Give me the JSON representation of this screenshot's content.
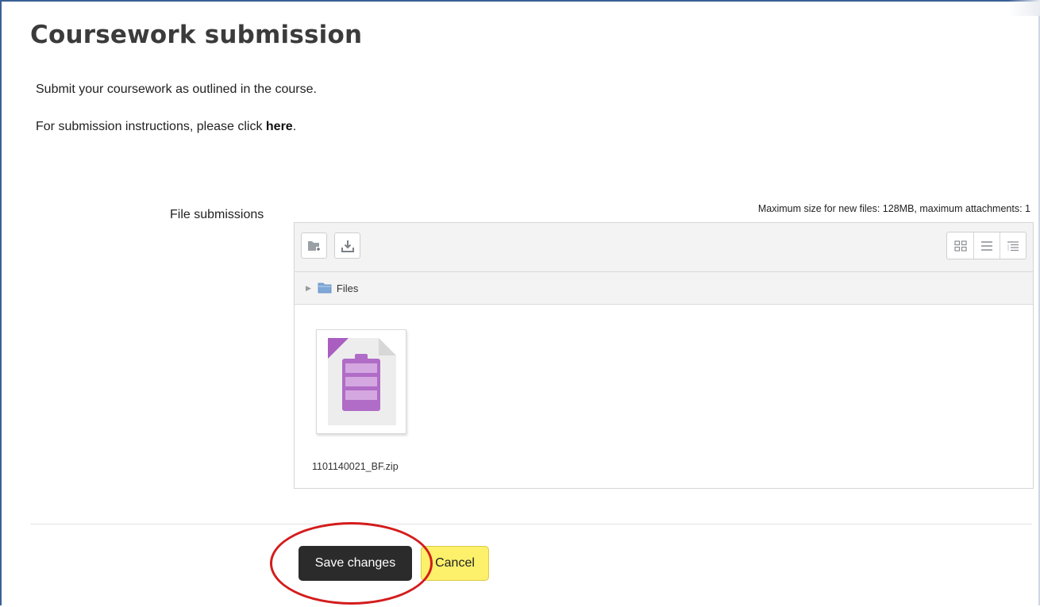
{
  "page": {
    "title": "Coursework submission",
    "intro": "Submit your coursework as outlined in the course.",
    "instructions_prefix": "For submission instructions, please click ",
    "instructions_link": "here",
    "instructions_suffix": "."
  },
  "file_field": {
    "label": "File submissions",
    "limit_note": "Maximum size for new files: 128MB, maximum attachments: 1",
    "toolbar": {
      "add_icon": "add-file-icon",
      "download_icon": "download-icon",
      "view_modes": [
        "grid-view-icon",
        "list-view-icon",
        "tree-view-icon"
      ]
    },
    "path": {
      "folder": "Files"
    },
    "files": [
      {
        "name": "1101140021_BF.zip",
        "icon": "archive-file-icon"
      }
    ]
  },
  "actions": {
    "save_label": "Save changes",
    "cancel_label": "Cancel"
  },
  "colors": {
    "save_bg": "#2b2b2b",
    "cancel_bg": "#fdf06a",
    "highlight": "#d41c1c",
    "archive_icon": "#a95ec0"
  }
}
